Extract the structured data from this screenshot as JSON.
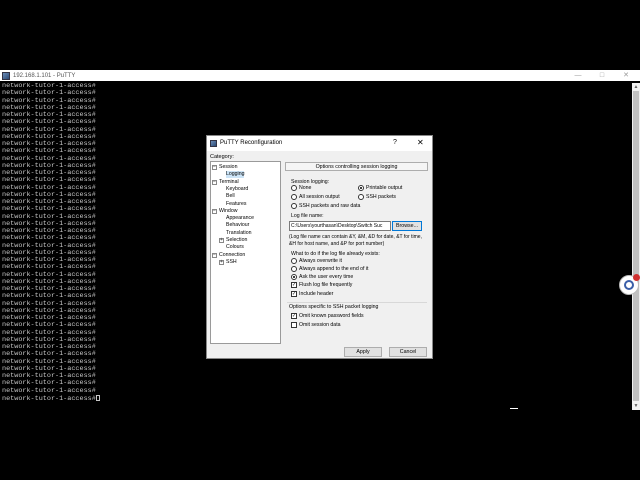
{
  "window": {
    "title": "192.168.1.101 - PuTTY",
    "controls": {
      "minimize": "—",
      "maximize": "□",
      "close": "✕"
    }
  },
  "terminal": {
    "prompt": "network-tutor-1-access#",
    "line_count": 44
  },
  "dialog": {
    "title": "PuTTY Reconfiguration",
    "help": "?",
    "close": "✕",
    "category_label": "Category:",
    "tree": [
      {
        "label": "Session",
        "level": 0,
        "expander": "−"
      },
      {
        "label": "Logging",
        "level": 1,
        "selected": true
      },
      {
        "label": "Terminal",
        "level": 0,
        "expander": "−"
      },
      {
        "label": "Keyboard",
        "level": 1
      },
      {
        "label": "Bell",
        "level": 1
      },
      {
        "label": "Features",
        "level": 1
      },
      {
        "label": "Window",
        "level": 0,
        "expander": "−"
      },
      {
        "label": "Appearance",
        "level": 1
      },
      {
        "label": "Behaviour",
        "level": 1
      },
      {
        "label": "Translation",
        "level": 1
      },
      {
        "label": "Selection",
        "level": 1,
        "expander": "+"
      },
      {
        "label": "Colours",
        "level": 1
      },
      {
        "label": "Connection",
        "level": 0,
        "expander": "−"
      },
      {
        "label": "SSH",
        "level": 1,
        "expander": "+"
      }
    ],
    "section_title": "Options controlling session logging",
    "session_logging": {
      "label": "Session logging:",
      "options": [
        "None",
        "Printable output",
        "All session output",
        "SSH packets",
        "SSH packets and raw data"
      ],
      "selected": "Printable output"
    },
    "log_file": {
      "label": "Log file name:",
      "value": "C:\\Users\\yourthasan\\Desktop\\Switch Suc",
      "browse": "Browse...",
      "hint": "(Log file name can contain &Y, &M, &D for date, &T for time, &H for host name, and &P for port number)"
    },
    "exists": {
      "label": "What to do if the log file already exists:",
      "options": [
        "Always overwrite it",
        "Always append to the end of it",
        "Ask the user every time"
      ],
      "selected": "Ask the user every time"
    },
    "flush": {
      "label": "Flush log file frequently",
      "checked": true
    },
    "header": {
      "label": "Include header",
      "checked": true
    },
    "ssh_options": {
      "label": "Options specific to SSH packet logging",
      "omit_password": {
        "label": "Omit known password fields",
        "checked": true
      },
      "omit_session": {
        "label": "Omit session data",
        "checked": false
      }
    },
    "apply": "Apply",
    "cancel": "Cancel"
  }
}
